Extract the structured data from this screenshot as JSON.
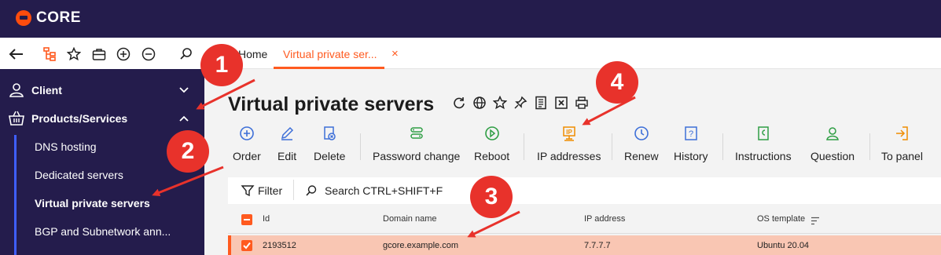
{
  "app": {
    "logo_text": "CORE"
  },
  "tabs": [
    {
      "label": "Home"
    },
    {
      "label": "Virtual private ser...",
      "close": "×"
    }
  ],
  "sidebar": {
    "items": [
      {
        "label": "Client",
        "icon": "client-icon",
        "expanded": false
      },
      {
        "label": "Products/Services",
        "icon": "basket-icon",
        "expanded": true
      }
    ],
    "sub_items": [
      {
        "label": "DNS hosting"
      },
      {
        "label": "Dedicated servers"
      },
      {
        "label": "Virtual private servers",
        "active": true
      },
      {
        "label": "BGP and Subnetwork ann..."
      }
    ]
  },
  "page": {
    "title": "Virtual private servers"
  },
  "actions": [
    {
      "label": "Order",
      "icon": "plus-circle-icon"
    },
    {
      "label": "Edit",
      "icon": "pencil-icon"
    },
    {
      "label": "Delete",
      "icon": "delete-icon"
    },
    {
      "label": "Password change",
      "icon": "password-icon"
    },
    {
      "label": "Reboot",
      "icon": "reboot-icon"
    },
    {
      "label": "IP addresses",
      "icon": "ip-icon"
    },
    {
      "label": "Renew",
      "icon": "clock-icon"
    },
    {
      "label": "History",
      "icon": "history-icon"
    },
    {
      "label": "Instructions",
      "icon": "instructions-icon"
    },
    {
      "label": "Question",
      "icon": "question-icon"
    },
    {
      "label": "To panel",
      "icon": "panel-icon"
    }
  ],
  "filter": {
    "label": "Filter",
    "search_placeholder": "Search CTRL+SHIFT+F"
  },
  "table": {
    "columns": [
      "Id",
      "Domain name",
      "IP address",
      "OS template"
    ],
    "rows": [
      {
        "id": "2193512",
        "domain": "gcore.example.com",
        "ip": "7.7.7.7",
        "os": "Ubuntu 20.04",
        "selected": true
      }
    ]
  },
  "callouts": [
    "1",
    "2",
    "3",
    "4"
  ],
  "colors": {
    "navy": "#241c4c",
    "accent": "#ff5a1f",
    "callout": "#e8322b",
    "selected_row": "#f9c6b3",
    "sub_line": "#3f5fff"
  }
}
